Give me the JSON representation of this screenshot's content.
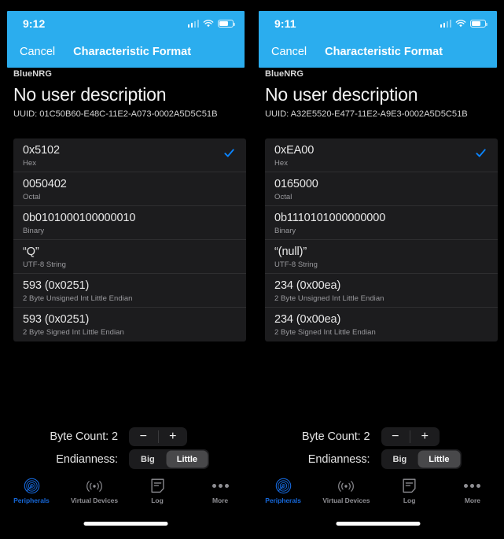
{
  "panels": [
    {
      "status": {
        "time": "9:12",
        "signal_icon": "signal-bars-icon",
        "wifi_icon": "wifi-icon",
        "battery_icon": "battery-icon"
      },
      "nav": {
        "cancel_label": "Cancel",
        "title": "Characteristic Format"
      },
      "meta": {
        "device": "BlueNRG",
        "description": "No user description",
        "uuid": "UUID: 01C50B60-E48C-11E2-A073-0002A5D5C51B"
      },
      "formats": [
        {
          "value": "0x5102",
          "label": "Hex",
          "selected": true
        },
        {
          "value": "0050402",
          "label": "Octal",
          "selected": false
        },
        {
          "value": "0b0101000100000010",
          "label": "Binary",
          "selected": false
        },
        {
          "value": "“Q”",
          "label": "UTF-8 String",
          "selected": false
        },
        {
          "value": "593 (0x0251)",
          "label": "2 Byte Unsigned Int Little Endian",
          "selected": false
        },
        {
          "value": "593 (0x0251)",
          "label": "2 Byte Signed Int Little Endian",
          "selected": false
        }
      ],
      "controls": {
        "byte_count_label": "Byte Count:",
        "byte_count_value": "2",
        "decrement_label": "−",
        "increment_label": "+",
        "endianness_label": "Endianness:",
        "endianness_options": [
          "Big",
          "Little"
        ],
        "endianness_selected": "Little"
      },
      "tabs": [
        {
          "label": "Peripherals",
          "icon": "peripherals-radar-icon",
          "active": true
        },
        {
          "label": "Virtual Devices",
          "icon": "broadcast-waves-icon",
          "active": false
        },
        {
          "label": "Log",
          "icon": "log-document-icon",
          "active": false
        },
        {
          "label": "More",
          "icon": "more-ellipsis-icon",
          "active": false
        }
      ]
    },
    {
      "status": {
        "time": "9:11",
        "signal_icon": "signal-bars-icon",
        "wifi_icon": "wifi-icon",
        "battery_icon": "battery-icon"
      },
      "nav": {
        "cancel_label": "Cancel",
        "title": "Characteristic Format"
      },
      "meta": {
        "device": "BlueNRG",
        "description": "No user description",
        "uuid": "UUID: A32E5520-E477-11E2-A9E3-0002A5D5C51B"
      },
      "formats": [
        {
          "value": "0xEA00",
          "label": "Hex",
          "selected": true
        },
        {
          "value": "0165000",
          "label": "Octal",
          "selected": false
        },
        {
          "value": "0b1110101000000000",
          "label": "Binary",
          "selected": false
        },
        {
          "value": "“(null)”",
          "label": "UTF-8 String",
          "selected": false
        },
        {
          "value": "234 (0x00ea)",
          "label": "2 Byte Unsigned Int Little Endian",
          "selected": false
        },
        {
          "value": "234 (0x00ea)",
          "label": "2 Byte Signed Int Little Endian",
          "selected": false
        }
      ],
      "controls": {
        "byte_count_label": "Byte Count:",
        "byte_count_value": "2",
        "decrement_label": "−",
        "increment_label": "+",
        "endianness_label": "Endianness:",
        "endianness_options": [
          "Big",
          "Little"
        ],
        "endianness_selected": "Little"
      },
      "tabs": [
        {
          "label": "Peripherals",
          "icon": "peripherals-radar-icon",
          "active": true
        },
        {
          "label": "Virtual Devices",
          "icon": "broadcast-waves-icon",
          "active": false
        },
        {
          "label": "Log",
          "icon": "log-document-icon",
          "active": false
        },
        {
          "label": "More",
          "icon": "more-ellipsis-icon",
          "active": false
        }
      ]
    }
  ],
  "colors": {
    "accent_blue": "#2BADEE",
    "check_blue": "#0a84ff",
    "tab_active": "#1667d8",
    "card_bg": "#1c1c1e",
    "background": "#000000"
  }
}
